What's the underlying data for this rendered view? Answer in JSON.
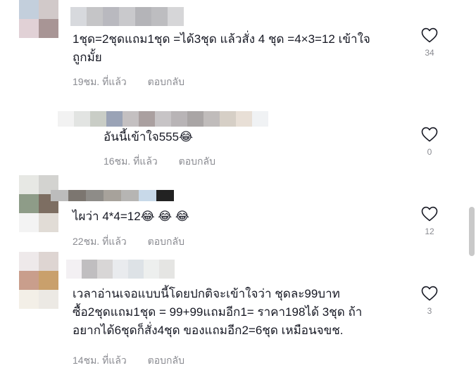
{
  "comments": [
    {
      "text_line1": "1ชุด=2ชุดแถม1ชุด =ได้3ชุด แล้วสั่ง 4 ชุด =4×3=12 เข้าใจ",
      "text_line2": "ถูกมั้ย",
      "time": "19ชม. ที่แล้ว",
      "reply_label": "ตอบกลับ",
      "likes": "34",
      "avatar_colors": [
        "#c3cfdc",
        "#d1c9c9",
        "#e1d1d6",
        "#a89595"
      ],
      "name_colors": [
        "#d7d9dd",
        "#c5c5c7",
        "#b9b9bf",
        "#c9c9cc",
        "#b4b4b8",
        "#bdbdc0",
        "#d6d6d8"
      ]
    },
    {
      "text": "อันนี้เข้าใจ555",
      "emoji": "😂",
      "time": "16ชม. ที่แล้ว",
      "reply_label": "ตอบกลับ",
      "likes": "0",
      "name_colors": [
        "#f2f2f2",
        "#e2e4e2",
        "#c9cdc6",
        "#9aa3b6",
        "#c4c0c1",
        "#aaa0a0",
        "#c7c4c6",
        "#b8b4b6",
        "#a9a5a5",
        "#c0bcbb",
        "#d6cfc6",
        "#e8dfd6",
        "#f0f2f4"
      ]
    },
    {
      "text": "ไผว่า 4*4=12",
      "emoji": "😂 😂 😂",
      "time": "22ชม. ที่แล้ว",
      "reply_label": "ตอบกลับ",
      "likes": "12",
      "avatar_colors": [
        "#e7e8e4",
        "#d3d3d0",
        "#8e9c88",
        "#7d6e62",
        "#f3f3f3",
        "#e1dcd6"
      ],
      "name_colors": [
        "#bcbcbc",
        "#7c7670",
        "#8e8c88",
        "#a7a29b",
        "#b6b5b3",
        "#c8d9e9",
        "#222222"
      ]
    },
    {
      "text_line1": "เวลาอ่านเจอแบบนี้โดยปกติจะเข้าใจว่า ชุดละ99บาท",
      "text_line2": "ซื้อ2ชุดแถม1ชุด = 99+99แถมอีก1= ราคา198ได้ 3ชุด ถ้า",
      "text_line3": "อยากได้6ชุดก็สั่ง4ชุด ของแถมอีก2=6ชุด เหมือนจขช.",
      "time": "14ชม. ที่แล้ว",
      "reply_label": "ตอบกลับ",
      "likes": "3",
      "avatar_colors": [
        "#eee9ea",
        "#ded5d2",
        "#c99e8c",
        "#c9a06c",
        "#f3efe7",
        "#ece9e4"
      ],
      "name_colors": [
        "#f3f0f3",
        "#c0bec0",
        "#d8d6d6",
        "#e9ebee",
        "#dde2e6",
        "#edefee",
        "#e5e5e3"
      ]
    }
  ],
  "icons": {
    "like": "heart-outline-icon"
  },
  "colors": {
    "text": "#161823",
    "meta": "#8a8b91",
    "icon": "#161823"
  }
}
